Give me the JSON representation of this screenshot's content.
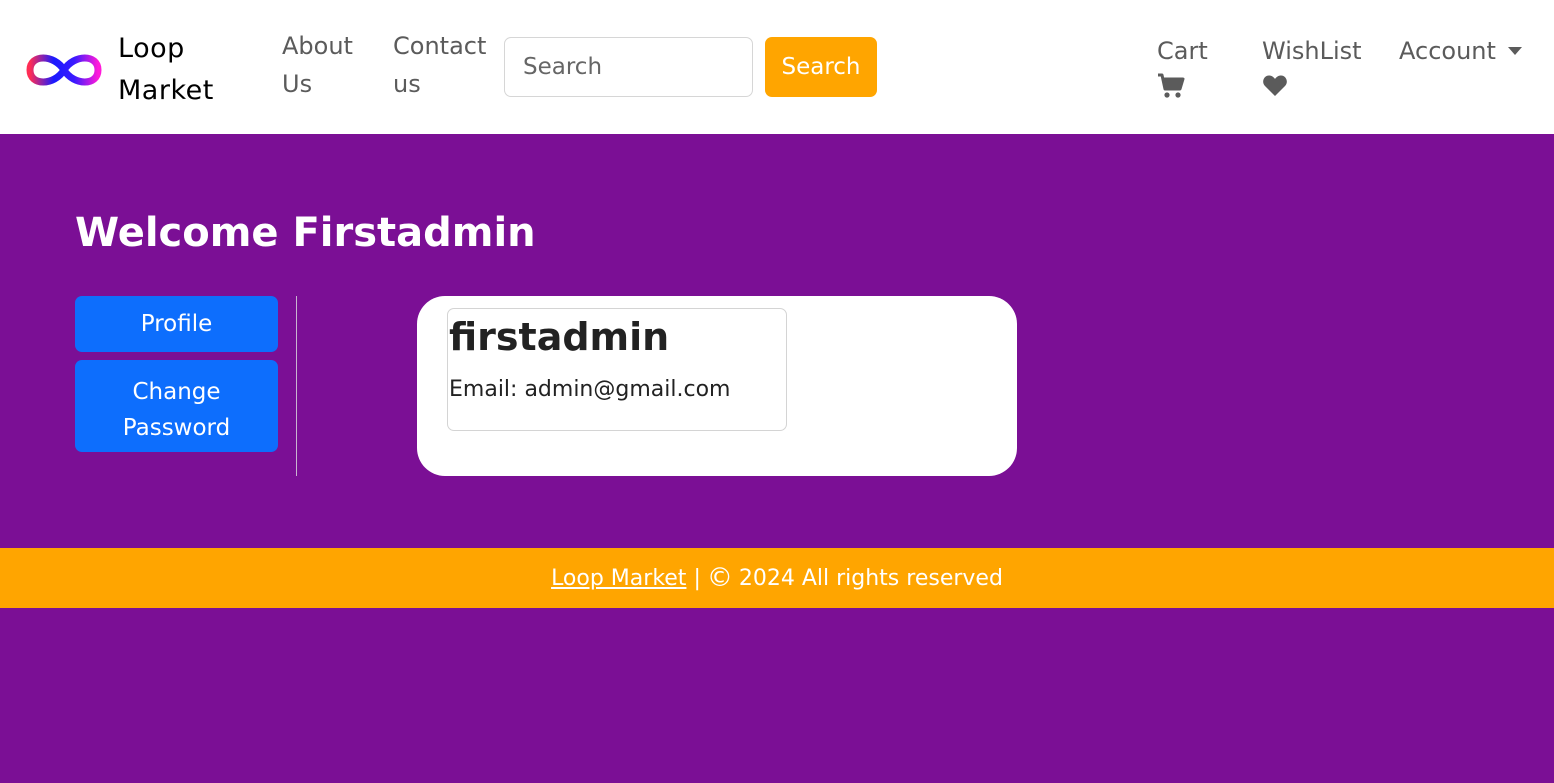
{
  "brand": {
    "name_line1": "Loop",
    "name_line2": "Market",
    "logo_icon": "infinity-icon"
  },
  "nav": {
    "about_line1": "About",
    "about_line2": "Us",
    "contact_line1": "Contact",
    "contact_line2": "us",
    "search_placeholder": "Search",
    "search_button": "Search",
    "cart_label": "Cart",
    "cart_icon": "cart-icon",
    "wishlist_label": "WishList",
    "wishlist_icon": "heart-icon",
    "account_label": "Account"
  },
  "main": {
    "welcome": "Welcome Firstadmin",
    "sidebar": {
      "profile": "Profile",
      "change_line1": "Change",
      "change_line2": "Password"
    },
    "profile_card": {
      "username": "firstadmin",
      "email": "Email: admin@gmail.com"
    }
  },
  "footer": {
    "link": "Loop Market",
    "separator": "|",
    "copyright_icon": "©",
    "text": "2024 All rights reserved"
  },
  "colors": {
    "background": "#7b0f95",
    "accent": "#ffa500",
    "primary_button": "#0d6efd"
  }
}
